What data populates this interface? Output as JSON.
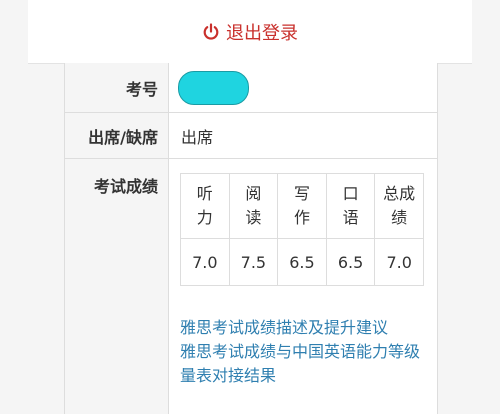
{
  "logout": {
    "label": "退出登录",
    "color": "#c9302c"
  },
  "rows": {
    "exam_no_label": "考号",
    "attendance_label": "出席/缺席",
    "attendance_value": "出席",
    "scores_label": "考试成绩"
  },
  "scores": {
    "headers": [
      "听\n力",
      "阅\n读",
      "写\n作",
      "口\n语",
      "总成\n绩"
    ],
    "values": [
      "7.0",
      "7.5",
      "6.5",
      "6.5",
      "7.0"
    ]
  },
  "links": {
    "link1": "雅思考试成绩描述及提升建议",
    "link2": "雅思考试成绩与中国英语能力等级量表对接结果"
  }
}
